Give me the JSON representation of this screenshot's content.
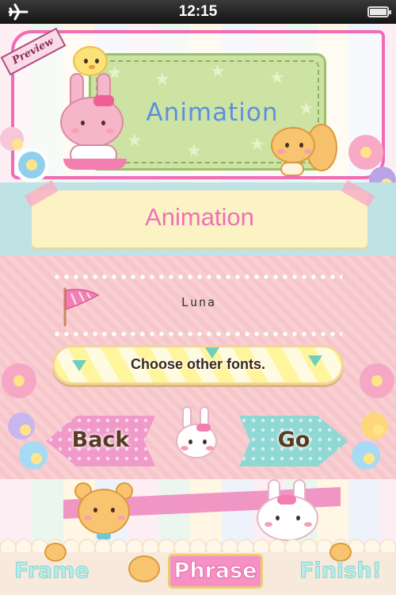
{
  "status_bar": {
    "time": "12:15"
  },
  "preview": {
    "ribbon_label": "Preview",
    "sample_text": "Animation"
  },
  "title": {
    "text": "Animation"
  },
  "font": {
    "name": "Luna"
  },
  "buttons": {
    "choose_fonts": "Choose other fonts.",
    "back": "Back",
    "go": "Go"
  },
  "tabs": [
    {
      "label": "Frame"
    },
    {
      "label": "Phrase",
      "selected": true
    },
    {
      "label": "Finish!"
    }
  ],
  "colors": {
    "accent_pink": "#f06cb5",
    "title_pink": "#ee70b8",
    "preview_blue": "#5d8fe0",
    "mint": "#8fd8d3",
    "panel_pink": "#f8cfd2"
  }
}
